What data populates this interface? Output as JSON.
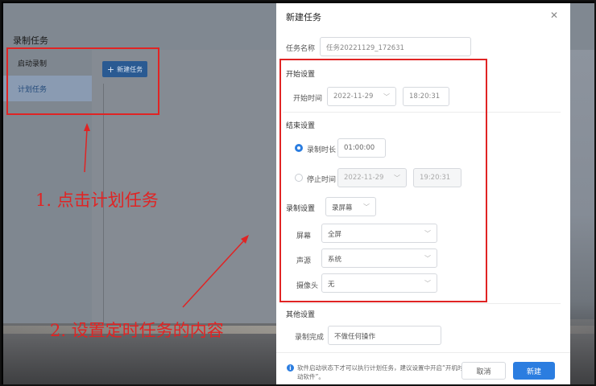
{
  "app": {
    "title": "录制任务",
    "sidebar": [
      {
        "label": "启动录制"
      },
      {
        "label": "计划任务"
      }
    ],
    "new_task_label": "新建任务",
    "new_task_icon": "plus-icon"
  },
  "annotations": {
    "note1": "1. 点击计划任务",
    "note2": "2. 设置定时任务的内容",
    "color": "#e02424"
  },
  "modal": {
    "title": "新建任务",
    "close_icon": "close-icon",
    "task_name_label": "任务名称",
    "task_name_value": "任务20221129_172631",
    "start_section": "开始设置",
    "start_time_label": "开始时间",
    "start_date": "2022-11-29",
    "start_time": "18:20:31",
    "end_section": "结束设置",
    "record_duration_label": "录制时长",
    "record_duration_value": "01:00:00",
    "end_time_label": "停止时间",
    "end_date": "2022-11-29",
    "end_time": "19:20:31",
    "record_setting_label": "录制设置",
    "record_setting_value": "录屏幕",
    "screen_label": "屏幕",
    "screen_value": "全屏",
    "audio_label": "声源",
    "audio_value": "系统",
    "camera_label": "摄像头",
    "camera_value": "无",
    "other_section": "其他设置",
    "after_record_label": "录制完成",
    "after_record_value": "不做任何操作",
    "hint": "软件启动状态下才可以执行计划任务，建议设置中开启“开机时自动启动软件”。",
    "cancel_label": "取消",
    "create_label": "新建",
    "accent": "#2b7de0"
  }
}
